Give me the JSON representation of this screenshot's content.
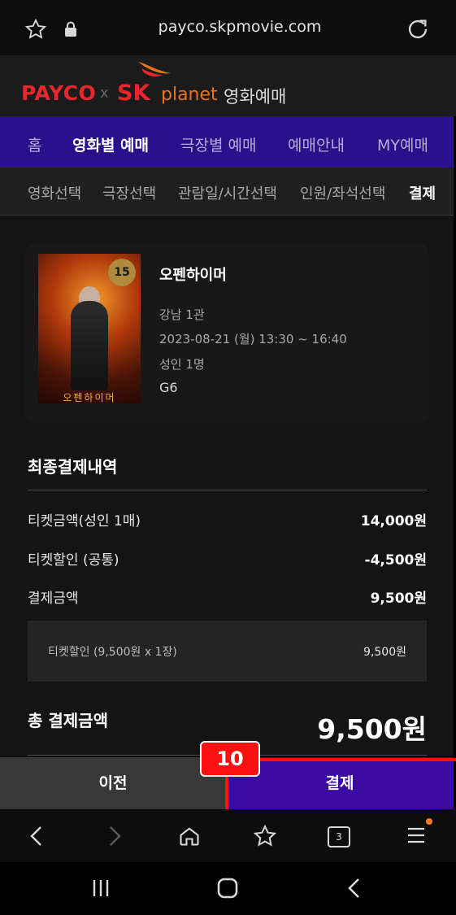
{
  "browser": {
    "url": "payco.skpmovie.com"
  },
  "brand": {
    "payco": "PAYCO",
    "separator": "x",
    "sk": "SK",
    "planet": "planet",
    "title": "영화예매"
  },
  "nav": [
    {
      "label": "홈"
    },
    {
      "label": "영화별 예매"
    },
    {
      "label": "극장별 예매"
    },
    {
      "label": "예매안내"
    },
    {
      "label": "MY예매"
    }
  ],
  "steps": [
    {
      "label": "영화선택"
    },
    {
      "label": "극장선택"
    },
    {
      "label": "관람일/시간선택"
    },
    {
      "label": "인원/좌석선택"
    },
    {
      "label": "결제"
    }
  ],
  "movie": {
    "title": "오펜하이머",
    "age_rating": "15",
    "poster_title": "오펜하이머",
    "theater": "강남 1관",
    "datetime": "2023-08-21 (월) 13:30 ~ 16:40",
    "people": "성인 1명",
    "seat": "G6"
  },
  "summary": {
    "heading": "최종결제내역",
    "rows": [
      {
        "label": "티켓금액(성인 1매)",
        "value": "14,000원"
      },
      {
        "label": "티켓할인 (공통)",
        "value": "-4,500원"
      },
      {
        "label": "결제금액",
        "value": "9,500원"
      }
    ],
    "detail": {
      "label": "티켓할인 (9,500원 x 1장)",
      "value": "9,500원"
    },
    "total_label": "총 결제금액",
    "total_value": "9,500원"
  },
  "buttons": {
    "prev": "이전",
    "pay": "결제"
  },
  "annotation": {
    "step_number": "10"
  },
  "toolbar": {
    "tab_count": "3"
  },
  "colors": {
    "nav_bg": "#28118a",
    "pay_bg": "#3a0aa3",
    "highlight": "#ff1010",
    "payco_red": "#e8262c",
    "planet_orange": "#e5731f"
  },
  "icons": [
    "star-icon",
    "lock-icon",
    "reload-icon",
    "back-icon",
    "forward-icon",
    "home-icon",
    "bookmarks-icon",
    "tabs-icon",
    "menu-icon",
    "recents-icon",
    "home-nav-icon",
    "back-nav-icon"
  ]
}
